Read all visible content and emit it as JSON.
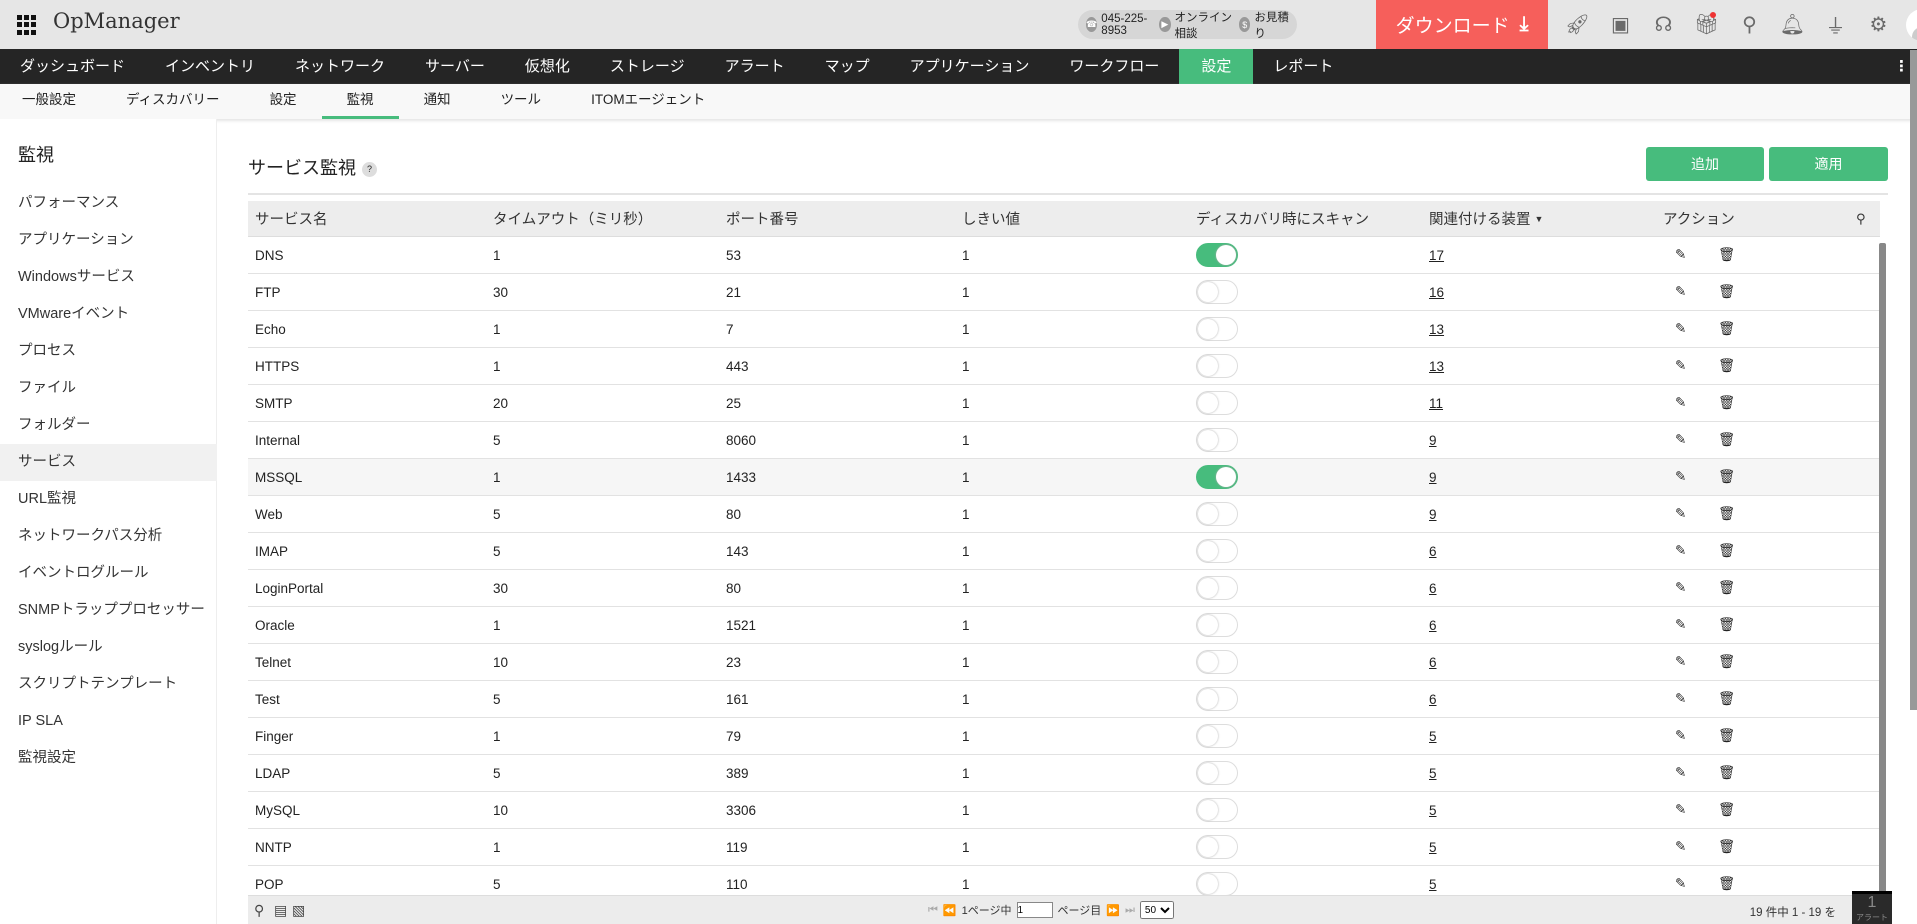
{
  "app": {
    "title": "OpManager"
  },
  "topbar": {
    "phone": "045-225-8953",
    "consult": "オンライン相談",
    "quote": "お見積り",
    "download": "ダウンロード"
  },
  "nav": [
    "ダッシュボード",
    "インベントリ",
    "ネットワーク",
    "サーバー",
    "仮想化",
    "ストレージ",
    "アラート",
    "マップ",
    "アプリケーション",
    "ワークフロー",
    "設定",
    "レポート"
  ],
  "subnav": [
    "一般設定",
    "ディスカバリー",
    "設定",
    "監視",
    "通知",
    "ツール",
    "ITOMエージェント"
  ],
  "sidebar": {
    "title": "監視",
    "items": [
      "パフォーマンス",
      "アプリケーション",
      "Windowsサービス",
      "VMwareイベント",
      "プロセス",
      "ファイル",
      "フォルダー",
      "サービス",
      "URL監視",
      "ネットワークパス分析",
      "イベントログルール",
      "SNMPトラッププロセッサー",
      "syslogルール",
      "スクリプトテンプレート",
      "IP SLA",
      "監視設定"
    ],
    "active": "サービス"
  },
  "page": {
    "title": "サービス監視",
    "help": "?",
    "add": "追加",
    "apply": "適用"
  },
  "table": {
    "columns": [
      "サービス名",
      "タイムアウト（ミリ秒）",
      "ポート番号",
      "しきい値",
      "ディスカバリ時にスキャン",
      "関連付ける装置",
      "アクション"
    ],
    "rows": [
      {
        "name": "DNS",
        "timeout": "1",
        "port": "53",
        "threshold": "1",
        "scan": true,
        "devices": "17"
      },
      {
        "name": "FTP",
        "timeout": "30",
        "port": "21",
        "threshold": "1",
        "scan": false,
        "devices": "16"
      },
      {
        "name": "Echo",
        "timeout": "1",
        "port": "7",
        "threshold": "1",
        "scan": false,
        "devices": "13"
      },
      {
        "name": "HTTPS",
        "timeout": "1",
        "port": "443",
        "threshold": "1",
        "scan": false,
        "devices": "13"
      },
      {
        "name": "SMTP",
        "timeout": "20",
        "port": "25",
        "threshold": "1",
        "scan": false,
        "devices": "11"
      },
      {
        "name": "Internal",
        "timeout": "5",
        "port": "8060",
        "threshold": "1",
        "scan": false,
        "devices": "9"
      },
      {
        "name": "MSSQL",
        "timeout": "1",
        "port": "1433",
        "threshold": "1",
        "scan": true,
        "devices": "9"
      },
      {
        "name": "Web",
        "timeout": "5",
        "port": "80",
        "threshold": "1",
        "scan": false,
        "devices": "9"
      },
      {
        "name": "IMAP",
        "timeout": "5",
        "port": "143",
        "threshold": "1",
        "scan": false,
        "devices": "6"
      },
      {
        "name": "LoginPortal",
        "timeout": "30",
        "port": "80",
        "threshold": "1",
        "scan": false,
        "devices": "6"
      },
      {
        "name": "Oracle",
        "timeout": "1",
        "port": "1521",
        "threshold": "1",
        "scan": false,
        "devices": "6"
      },
      {
        "name": "Telnet",
        "timeout": "10",
        "port": "23",
        "threshold": "1",
        "scan": false,
        "devices": "6"
      },
      {
        "name": "Test",
        "timeout": "5",
        "port": "161",
        "threshold": "1",
        "scan": false,
        "devices": "6"
      },
      {
        "name": "Finger",
        "timeout": "1",
        "port": "79",
        "threshold": "1",
        "scan": false,
        "devices": "5"
      },
      {
        "name": "LDAP",
        "timeout": "5",
        "port": "389",
        "threshold": "1",
        "scan": false,
        "devices": "5"
      },
      {
        "name": "MySQL",
        "timeout": "10",
        "port": "3306",
        "threshold": "1",
        "scan": false,
        "devices": "5"
      },
      {
        "name": "NNTP",
        "timeout": "1",
        "port": "119",
        "threshold": "1",
        "scan": false,
        "devices": "5"
      },
      {
        "name": "POP",
        "timeout": "5",
        "port": "110",
        "threshold": "1",
        "scan": false,
        "devices": "5"
      }
    ]
  },
  "pager": {
    "page_of": "1ページ中",
    "page_value": "1",
    "page_suffix": "ページ目",
    "per_page": "50",
    "count": "19 件中 1 - 19 を"
  },
  "alert": {
    "count": "1",
    "label": "アラート"
  },
  "colors": {
    "accent": "#47bc7d",
    "download": "#f65f5b",
    "nav": "#252525"
  }
}
